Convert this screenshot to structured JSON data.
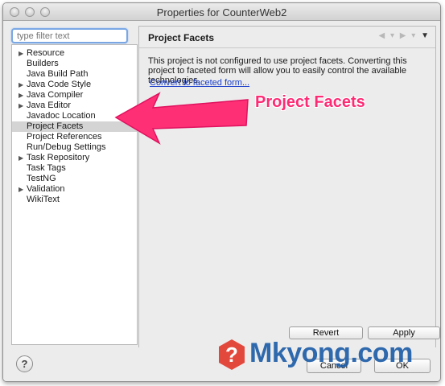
{
  "window": {
    "title": "Properties for CounterWeb2"
  },
  "filter": {
    "placeholder": "type filter text"
  },
  "tree": {
    "items": [
      {
        "label": "Resource",
        "expandable": true
      },
      {
        "label": "Builders",
        "expandable": false
      },
      {
        "label": "Java Build Path",
        "expandable": false
      },
      {
        "label": "Java Code Style",
        "expandable": true
      },
      {
        "label": "Java Compiler",
        "expandable": true
      },
      {
        "label": "Java Editor",
        "expandable": true
      },
      {
        "label": "Javadoc Location",
        "expandable": false
      },
      {
        "label": "Project Facets",
        "expandable": false,
        "selected": true
      },
      {
        "label": "Project References",
        "expandable": false
      },
      {
        "label": "Run/Debug Settings",
        "expandable": false
      },
      {
        "label": "Task Repository",
        "expandable": true
      },
      {
        "label": "Task Tags",
        "expandable": false
      },
      {
        "label": "TestNG",
        "expandable": false
      },
      {
        "label": "Validation",
        "expandable": true
      },
      {
        "label": "WikiText",
        "expandable": false
      }
    ]
  },
  "page": {
    "title": "Project Facets",
    "description": "This project is not configured to use project facets. Converting this project to faceted form will allow you to easily control the available technologies.",
    "convert_link": "Convert to faceted form...",
    "revert_label": "Revert",
    "apply_label": "Apply"
  },
  "footer": {
    "help_label": "?",
    "cancel_label": "Cancel",
    "ok_label": "OK"
  },
  "annotation": {
    "text": "Project Facets",
    "color": "#ff2a74"
  },
  "watermark": {
    "badge": "?",
    "text": "Mkyong.com"
  },
  "colors": {
    "link": "#1a3ec9",
    "selection": "#d4d4d4",
    "focus_ring": "#7aa7e4"
  }
}
